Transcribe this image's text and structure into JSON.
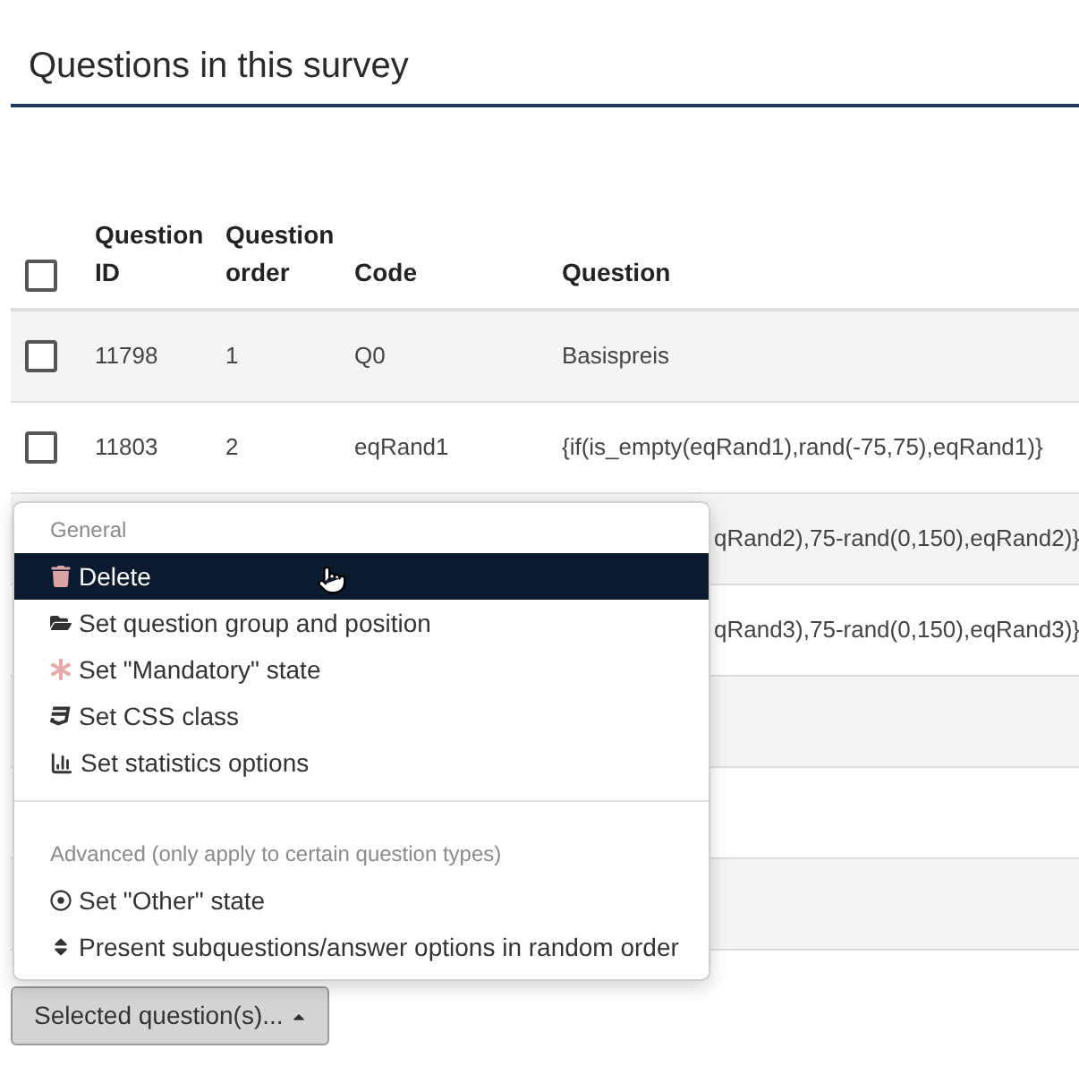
{
  "page": {
    "title": "Questions in this survey"
  },
  "table": {
    "select_all": {
      "checked": false
    },
    "columns": [
      "Question ID",
      "Question order",
      "Code",
      "Question"
    ],
    "rows": [
      {
        "checked": false,
        "id": "11798",
        "order": "1",
        "code": "Q0",
        "question": "Basispreis"
      },
      {
        "checked": false,
        "id": "11803",
        "order": "2",
        "code": "eqRand1",
        "question": "{if(is_empty(eqRand1),rand(-75,75),eqRand1)}"
      },
      {
        "question": "qRand2),75-rand(0,150),eqRand2)}"
      },
      {
        "question": "qRand3),75-rand(0,150),eqRand3)}"
      },
      {},
      {},
      {}
    ]
  },
  "menu": {
    "sections": [
      {
        "header": "General",
        "items": [
          {
            "label": "Delete",
            "selected": true
          },
          {
            "label": "Set question group and position",
            "selected": false
          },
          {
            "label": "Set \"Mandatory\" state",
            "selected": false
          },
          {
            "label": "Set CSS class",
            "selected": false
          },
          {
            "label": "Set statistics options",
            "selected": false
          }
        ]
      },
      {
        "header": "Advanced (only apply to certain question types)",
        "items": [
          {
            "label": "Set \"Other\" state",
            "selected": false
          },
          {
            "label": "Present subquestions/answer options in random order",
            "selected": false
          }
        ]
      }
    ]
  },
  "button": {
    "label": "Selected question(s)...",
    "expanded": true
  }
}
